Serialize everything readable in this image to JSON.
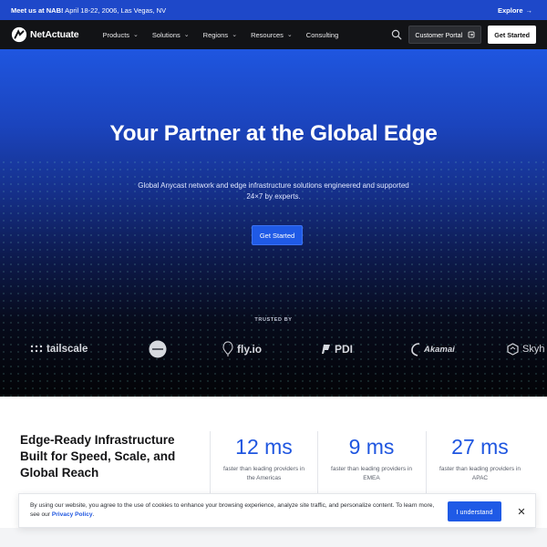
{
  "announcement": {
    "bold": "Meet us at NAB!",
    "text": " April 18-22, 2006, Las Vegas, NV",
    "explore_label": "Explore"
  },
  "nav": {
    "brand": "NetActuate",
    "menu": [
      {
        "label": "Products",
        "dropdown": true
      },
      {
        "label": "Solutions",
        "dropdown": true
      },
      {
        "label": "Regions",
        "dropdown": true
      },
      {
        "label": "Resources",
        "dropdown": true
      },
      {
        "label": "Consulting",
        "dropdown": false
      }
    ],
    "portal_label": "Customer Portal",
    "get_started_label": "Get Started"
  },
  "hero": {
    "title": "Your Partner at the Global Edge",
    "subtitle": "Global Anycast network and edge infrastructure solutions engineered and supported 24×7 by experts.",
    "cta_label": "Get Started",
    "trusted_by": "TRUSTED BY",
    "logos": [
      "tailscale",
      "fly.io",
      "PDI",
      "Akamai",
      "Skyh"
    ]
  },
  "stats": {
    "heading": "Edge-Ready Infrastructure Built for Speed, Scale, and Global Reach",
    "items": [
      {
        "value": "12 ms",
        "desc": "faster than leading providers in the Americas"
      },
      {
        "value": "9 ms",
        "desc": "faster than leading providers in EMEA"
      },
      {
        "value": "27 ms",
        "desc": "faster than leading providers in APAC"
      }
    ]
  },
  "cookie": {
    "text": "By using our website, you agree to the use of cookies to enhance your browsing experience, analyze site traffic, and personalize content. To learn more, see our ",
    "link": "Privacy Policy",
    "end": ".",
    "accept_label": "I understand",
    "close_symbol": "✕"
  },
  "colors": {
    "accent": "#1f56e0",
    "nav_bg": "#121316",
    "announce_bg": "#1e48c9"
  }
}
